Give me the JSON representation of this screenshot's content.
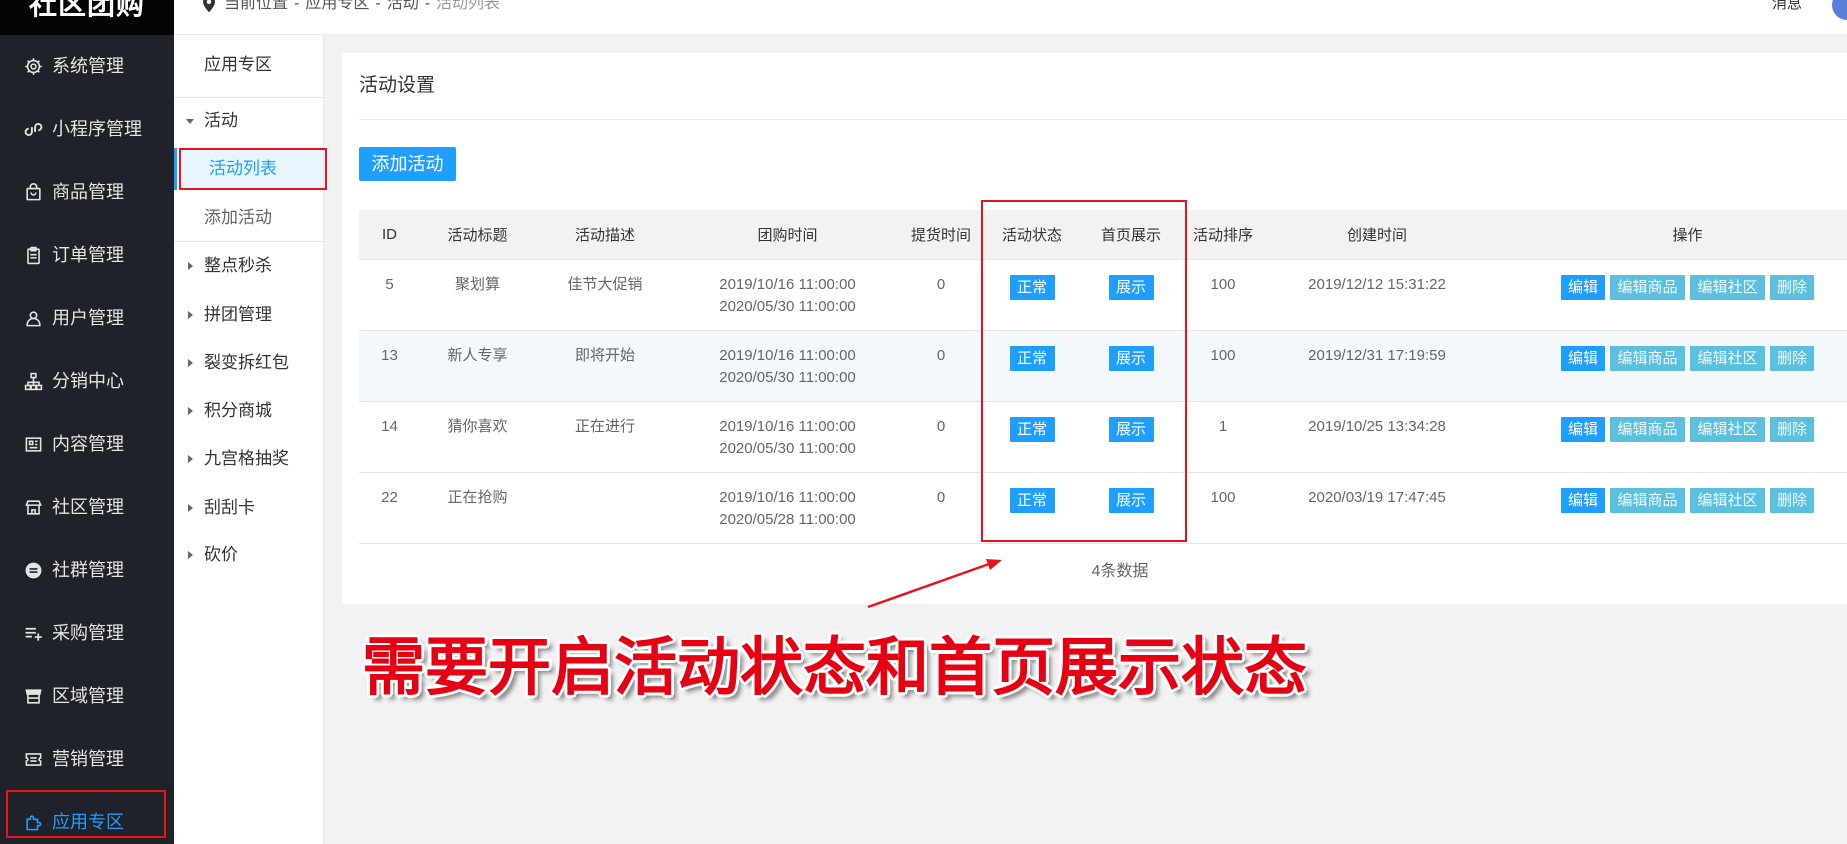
{
  "app": {
    "logo": "社区团购"
  },
  "header": {
    "breadcrumb_label": "当前位置",
    "separator": "-",
    "breadcrumb": [
      "应用专区",
      "活动",
      "活动列表"
    ],
    "messages": "消息",
    "icons": {
      "location": "location-pin-icon"
    }
  },
  "sidebar": {
    "items": [
      {
        "label": "系统管理",
        "icon": "gear-icon",
        "active": false
      },
      {
        "label": "小程序管理",
        "icon": "miniprogram-icon",
        "active": false
      },
      {
        "label": "商品管理",
        "icon": "shopping-bag-icon",
        "active": false
      },
      {
        "label": "订单管理",
        "icon": "clipboard-icon",
        "active": false
      },
      {
        "label": "用户管理",
        "icon": "user-icon",
        "active": false
      },
      {
        "label": "分销中心",
        "icon": "sitemap-icon",
        "active": false
      },
      {
        "label": "内容管理",
        "icon": "newspaper-icon",
        "active": false
      },
      {
        "label": "社区管理",
        "icon": "storefront-icon",
        "active": false
      },
      {
        "label": "社群管理",
        "icon": "minus-circle-icon",
        "active": false
      },
      {
        "label": "采购管理",
        "icon": "playlist-add-icon",
        "active": false
      },
      {
        "label": "区域管理",
        "icon": "shop-icon",
        "active": false
      },
      {
        "label": "营销管理",
        "icon": "ticket-icon",
        "active": false
      },
      {
        "label": "应用专区",
        "icon": "puzzle-icon",
        "active": true
      }
    ]
  },
  "subnav": {
    "title": "应用专区",
    "groups": [
      {
        "label": "活动",
        "expanded": true,
        "children": [
          {
            "label": "活动列表",
            "selected": true
          },
          {
            "label": "添加活动",
            "selected": false
          }
        ]
      },
      {
        "label": "整点秒杀",
        "expanded": false
      },
      {
        "label": "拼团管理",
        "expanded": false
      },
      {
        "label": "裂变拆红包",
        "expanded": false
      },
      {
        "label": "积分商城",
        "expanded": false
      },
      {
        "label": "九宫格抽奖",
        "expanded": false
      },
      {
        "label": "刮刮卡",
        "expanded": false
      },
      {
        "label": "砍价",
        "expanded": false
      }
    ]
  },
  "card": {
    "title": "活动设置",
    "add_button": "添加活动"
  },
  "table": {
    "columns": [
      "ID",
      "活动标题",
      "活动描述",
      "团购时间",
      "提货时间",
      "活动状态",
      "首页展示",
      "活动排序",
      "创建时间",
      "操作"
    ],
    "rows": [
      {
        "id": "5",
        "title": "聚划算",
        "description": "佳节大促销",
        "group_start": "2019/10/16 11:00:00",
        "group_end": "2020/05/30 11:00:00",
        "pickup": "0",
        "status": "正常",
        "homepage": "展示",
        "sort": "100",
        "created": "2019/12/12 15:31:22"
      },
      {
        "id": "13",
        "title": "新人专享",
        "description": "即将开始",
        "group_start": "2019/10/16 11:00:00",
        "group_end": "2020/05/30 11:00:00",
        "pickup": "0",
        "status": "正常",
        "homepage": "展示",
        "sort": "100",
        "created": "2019/12/31 17:19:59"
      },
      {
        "id": "14",
        "title": "猜你喜欢",
        "description": "正在进行",
        "group_start": "2019/10/16 11:00:00",
        "group_end": "2020/05/30 11:00:00",
        "pickup": "0",
        "status": "正常",
        "homepage": "展示",
        "sort": "1",
        "created": "2019/10/25 13:34:28"
      },
      {
        "id": "22",
        "title": "正在抢购",
        "description": "",
        "group_start": "2019/10/16 11:00:00",
        "group_end": "2020/05/28 11:00:00",
        "pickup": "0",
        "status": "正常",
        "homepage": "展示",
        "sort": "100",
        "created": "2020/03/19 17:47:45"
      }
    ],
    "actions": [
      "编辑",
      "编辑商品",
      "编辑社区",
      "删除"
    ],
    "footer": "4条数据"
  },
  "annotation": {
    "text": "需要开启活动状态和首页展示状态"
  },
  "colors": {
    "accent": "#1e9fff",
    "light_button": "#5bc0de",
    "sidebar_bg": "#20222a",
    "logo_bg": "#050505",
    "annotation_text": "#e60012",
    "highlight_box": "#e8141a"
  }
}
